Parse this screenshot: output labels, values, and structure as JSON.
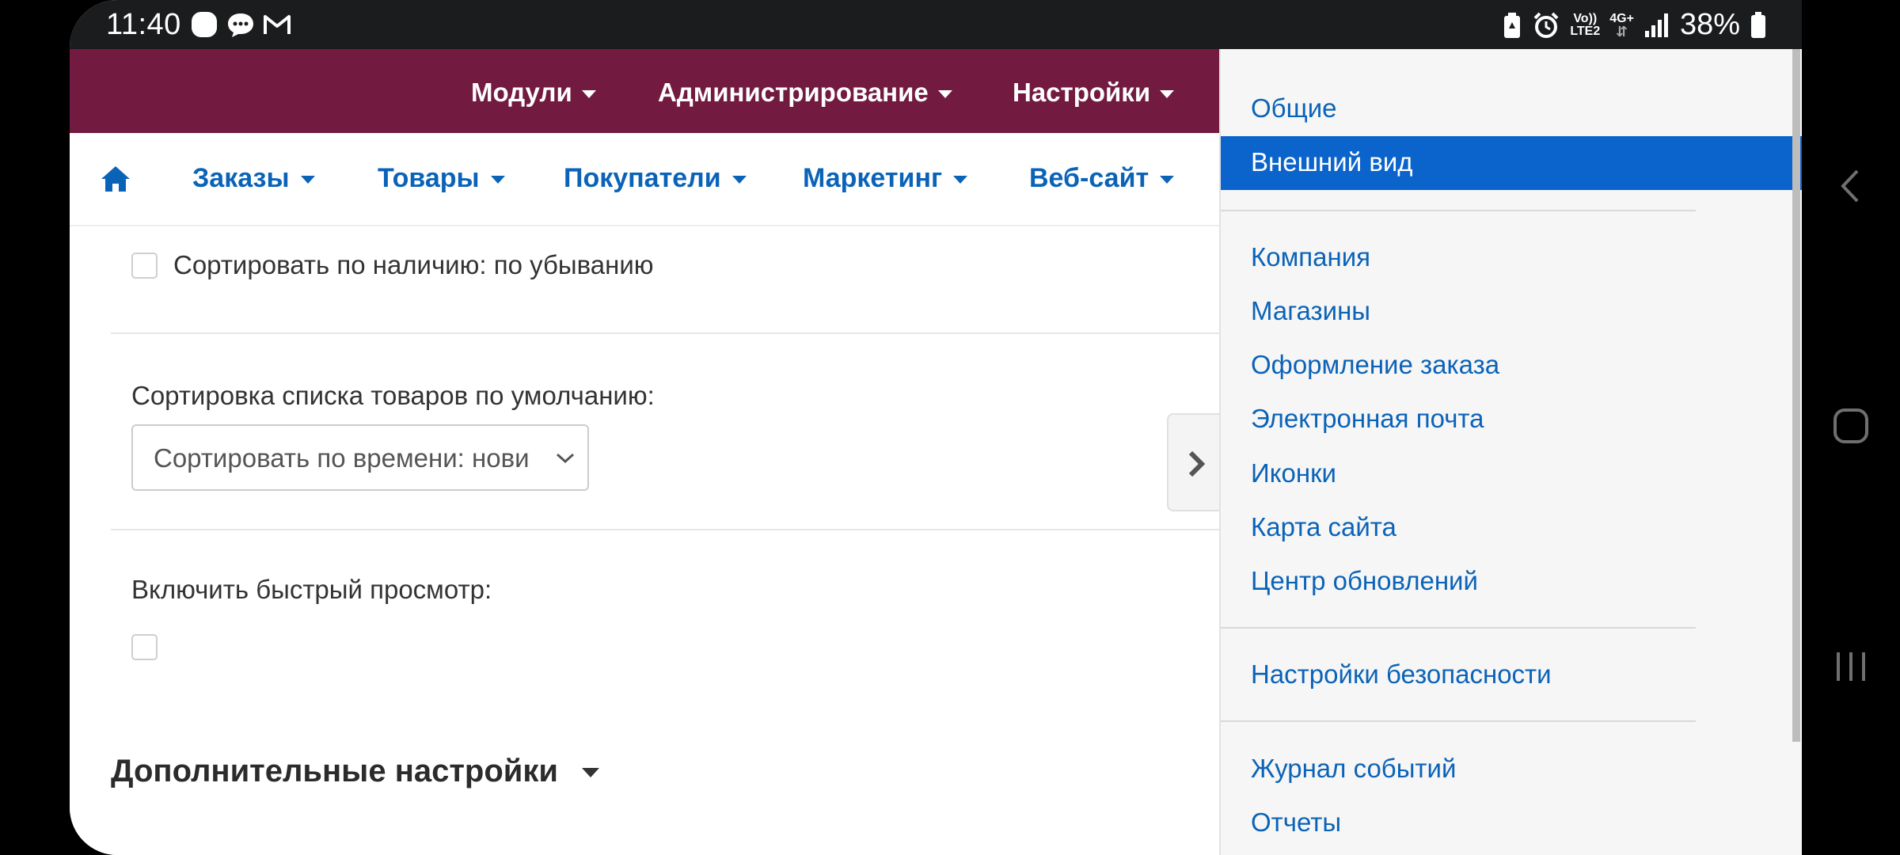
{
  "status_bar": {
    "time": "11:40",
    "battery": "38%",
    "network_top": "Vo))",
    "network_bottom": "LTE2",
    "network_type": "4G+",
    "icons_left": [
      "circle-icon",
      "chat-icon",
      "gmail-icon"
    ],
    "icons_right": [
      "battery-saver-icon",
      "alarm-icon",
      "signal-icon",
      "battery-icon"
    ]
  },
  "top_nav": {
    "items": [
      {
        "label": "Модули"
      },
      {
        "label": "Администрирование"
      },
      {
        "label": "Настройки"
      }
    ],
    "background": "#731a41"
  },
  "secondary_nav": {
    "home_icon": "home-icon",
    "items": [
      {
        "label": "Заказы"
      },
      {
        "label": "Товары"
      },
      {
        "label": "Покупатели"
      },
      {
        "label": "Маркетинг"
      },
      {
        "label": "Веб-сайт"
      }
    ],
    "accent": "#0b63b8"
  },
  "content": {
    "sort_by_stock_label": "Сортировать по наличию: по убыванию",
    "default_sort_label": "Сортировка списка товаров по умолчанию:",
    "default_sort_value": "Сортировать по времени: нови",
    "quick_view_label": "Включить быстрый просмотр:",
    "advanced_settings_title": "Дополнительные настройки"
  },
  "dropdown": {
    "items": [
      {
        "label": "Общие"
      },
      {
        "label": "Внешний вид",
        "active": true
      },
      {
        "label": "Компания"
      },
      {
        "label": "Магазины"
      },
      {
        "label": "Оформление заказа"
      },
      {
        "label": "Электронная почта"
      },
      {
        "label": "Иконки"
      },
      {
        "label": "Карта сайта"
      },
      {
        "label": "Центр обновлений"
      },
      {
        "label": "Настройки безопасности"
      },
      {
        "label": "Журнал событий"
      },
      {
        "label": "Отчеты"
      }
    ],
    "active_color": "#0b63cc"
  }
}
